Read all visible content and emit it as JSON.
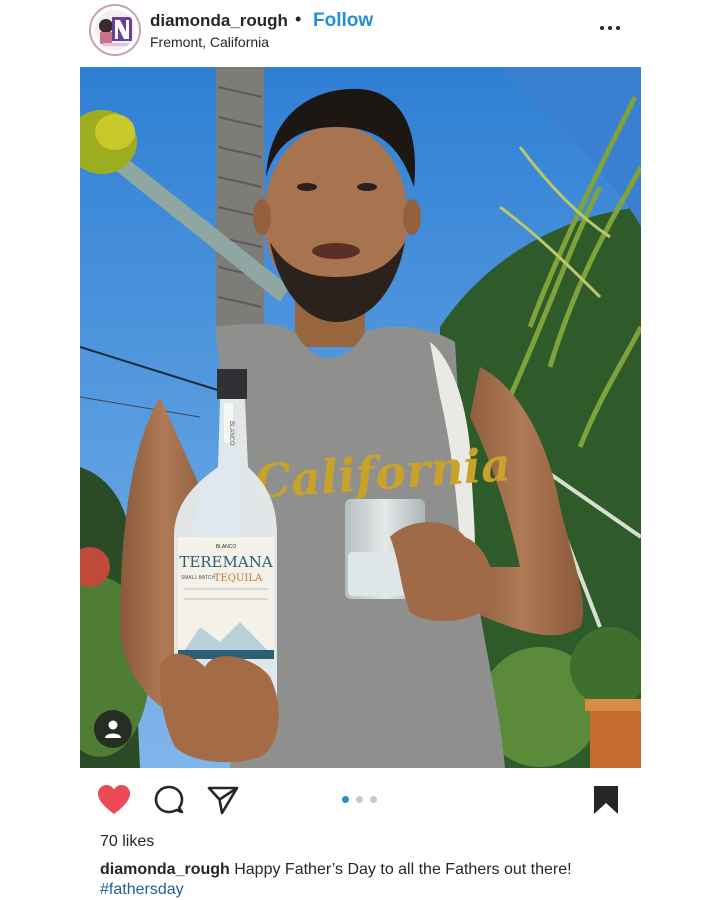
{
  "post": {
    "username": "diamonda_rough",
    "separator": "•",
    "follow_label": "Follow",
    "location": "Fremont, California",
    "likes": "70 likes",
    "caption_user": "diamonda_rough",
    "caption_text": " Happy Father’s Day to all the Fathers out there!",
    "hashtag": "#fathersday",
    "carousel": {
      "total": 3,
      "active_index": 1
    }
  },
  "photo": {
    "shirt_text": "California",
    "bottle_brand": "TEREMANA",
    "bottle_type": "TEQUILA",
    "bottle_sub": "SMALL BATCH",
    "bottle_top": "BLANCO",
    "bottle_side": "BLANCO"
  },
  "colors": {
    "accent": "#1f8fd6",
    "heart": "#ed4956",
    "text": "#262626",
    "sky": "#3d8fd9"
  },
  "icons": {
    "heart": "heart-icon",
    "comment": "comment-icon",
    "share": "share-icon",
    "save": "bookmark-icon",
    "more": "more-options-icon",
    "tag": "user-tag-icon"
  }
}
